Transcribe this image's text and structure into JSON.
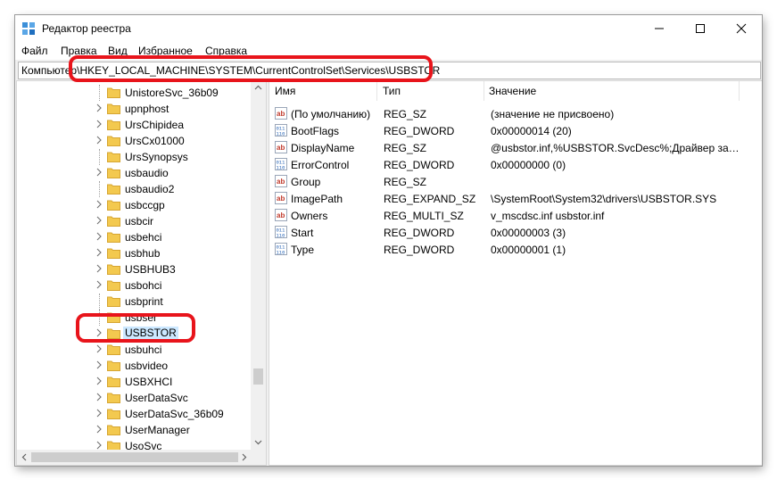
{
  "window": {
    "title": "Редактор реестра",
    "icon": "registry-editor-icon"
  },
  "menu": [
    "Файл",
    "Правка",
    "Вид",
    "Избранное",
    "Справка"
  ],
  "address": {
    "prefix": "Компьютер",
    "path": "\\HKEY_LOCAL_MACHINE\\SYSTEM\\CurrentControlSet\\Services\\USBSTOR"
  },
  "tree": {
    "items": [
      {
        "label": "UnistoreSvc_36b09",
        "expandable": false
      },
      {
        "label": "upnphost",
        "expandable": true
      },
      {
        "label": "UrsChipidea",
        "expandable": true
      },
      {
        "label": "UrsCx01000",
        "expandable": true
      },
      {
        "label": "UrsSynopsys",
        "expandable": false
      },
      {
        "label": "usbaudio",
        "expandable": true
      },
      {
        "label": "usbaudio2",
        "expandable": false
      },
      {
        "label": "usbccgp",
        "expandable": true
      },
      {
        "label": "usbcir",
        "expandable": true
      },
      {
        "label": "usbehci",
        "expandable": true
      },
      {
        "label": "usbhub",
        "expandable": true
      },
      {
        "label": "USBHUB3",
        "expandable": true
      },
      {
        "label": "usbohci",
        "expandable": true
      },
      {
        "label": "usbprint",
        "expandable": false
      },
      {
        "label": "usbser",
        "expandable": false
      },
      {
        "label": "USBSTOR",
        "expandable": true,
        "selected": true
      },
      {
        "label": "usbuhci",
        "expandable": true
      },
      {
        "label": "usbvideo",
        "expandable": true
      },
      {
        "label": "USBXHCI",
        "expandable": true
      },
      {
        "label": "UserDataSvc",
        "expandable": true
      },
      {
        "label": "UserDataSvc_36b09",
        "expandable": true
      },
      {
        "label": "UserManager",
        "expandable": true
      },
      {
        "label": "UsoSvc",
        "expandable": true
      }
    ]
  },
  "values": {
    "columns": [
      "Имя",
      "Тип",
      "Значение"
    ],
    "rows": [
      {
        "icon": "string-value-icon",
        "name": "(По умолчанию)",
        "type": "REG_SZ",
        "data": "(значение не присвоено)"
      },
      {
        "icon": "binary-value-icon",
        "name": "BootFlags",
        "type": "REG_DWORD",
        "data": "0x00000014 (20)"
      },
      {
        "icon": "string-value-icon",
        "name": "DisplayName",
        "type": "REG_SZ",
        "data": "@usbstor.inf,%USBSTOR.SvcDesc%;Драйвер запо..."
      },
      {
        "icon": "binary-value-icon",
        "name": "ErrorControl",
        "type": "REG_DWORD",
        "data": "0x00000000 (0)"
      },
      {
        "icon": "string-value-icon",
        "name": "Group",
        "type": "REG_SZ",
        "data": ""
      },
      {
        "icon": "string-value-icon",
        "name": "ImagePath",
        "type": "REG_EXPAND_SZ",
        "data": "\\SystemRoot\\System32\\drivers\\USBSTOR.SYS"
      },
      {
        "icon": "string-value-icon",
        "name": "Owners",
        "type": "REG_MULTI_SZ",
        "data": "v_mscdsc.inf usbstor.inf"
      },
      {
        "icon": "binary-value-icon",
        "name": "Start",
        "type": "REG_DWORD",
        "data": "0x00000003 (3)"
      },
      {
        "icon": "binary-value-icon",
        "name": "Type",
        "type": "REG_DWORD",
        "data": "0x00000001 (1)"
      }
    ]
  },
  "colors": {
    "highlight": "#e8141b",
    "selection": "#cce8ff",
    "folder": "#f3c94f"
  }
}
